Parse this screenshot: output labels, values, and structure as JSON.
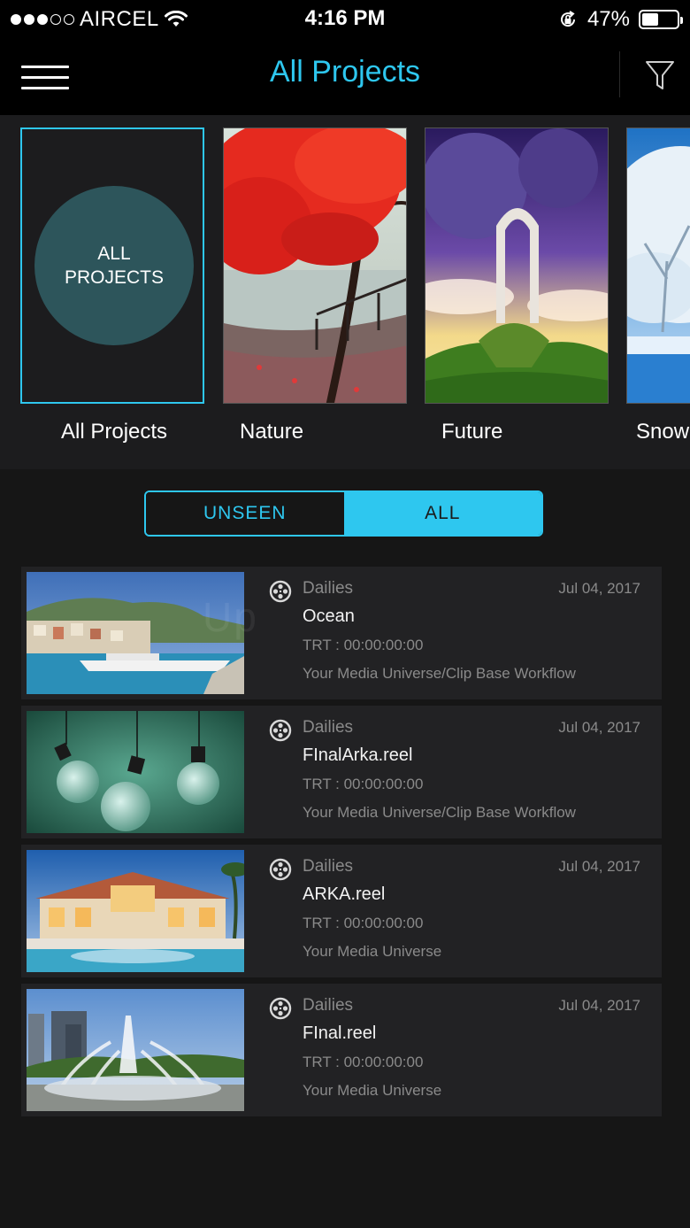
{
  "status_bar": {
    "carrier": "AIRCEL",
    "time": "4:16 PM",
    "battery": "47%",
    "battery_level": 0.47,
    "signal_dots_filled": 3,
    "signal_dots_total": 5,
    "icons": [
      "signal-dots-icon",
      "wifi-icon",
      "rotation-lock-icon",
      "battery-icon"
    ]
  },
  "nav": {
    "title": "All Projects",
    "accent_color": "#2ec7ef",
    "icons": [
      "hamburger-menu-icon",
      "filter-icon"
    ]
  },
  "categories": [
    {
      "label": "All Projects",
      "circle_text_1": "ALL",
      "circle_text_2": "PROJECTS",
      "selected": true
    },
    {
      "label": "Nature",
      "selected": false
    },
    {
      "label": "Future",
      "selected": false
    },
    {
      "label": "Snow",
      "selected": false
    }
  ],
  "segment": {
    "unseen_label": "UNSEEN",
    "all_label": "ALL",
    "active": "ALL"
  },
  "watermark": "Up",
  "projects": [
    {
      "category": "Dailies",
      "date": "Jul 04, 2017",
      "title": "Ocean",
      "trt": "TRT :  00:00:00:00",
      "path": "Your Media Universe/Clip Base Workflow",
      "thumb": "harbor"
    },
    {
      "category": "Dailies",
      "date": "Jul 04, 2017",
      "title": "FInalArka.reel",
      "trt": "TRT :  00:00:00:00",
      "path": "Your Media Universe/Clip Base Workflow",
      "thumb": "bulbs"
    },
    {
      "category": "Dailies",
      "date": "Jul 04, 2017",
      "title": "ARKA.reel",
      "trt": "TRT :  00:00:00:00",
      "path": "Your Media Universe",
      "thumb": "villa"
    },
    {
      "category": "Dailies",
      "date": "Jul 04, 2017",
      "title": "FInal.reel",
      "trt": "TRT :  00:00:00:00",
      "path": "Your Media Universe",
      "thumb": "fountain"
    }
  ]
}
